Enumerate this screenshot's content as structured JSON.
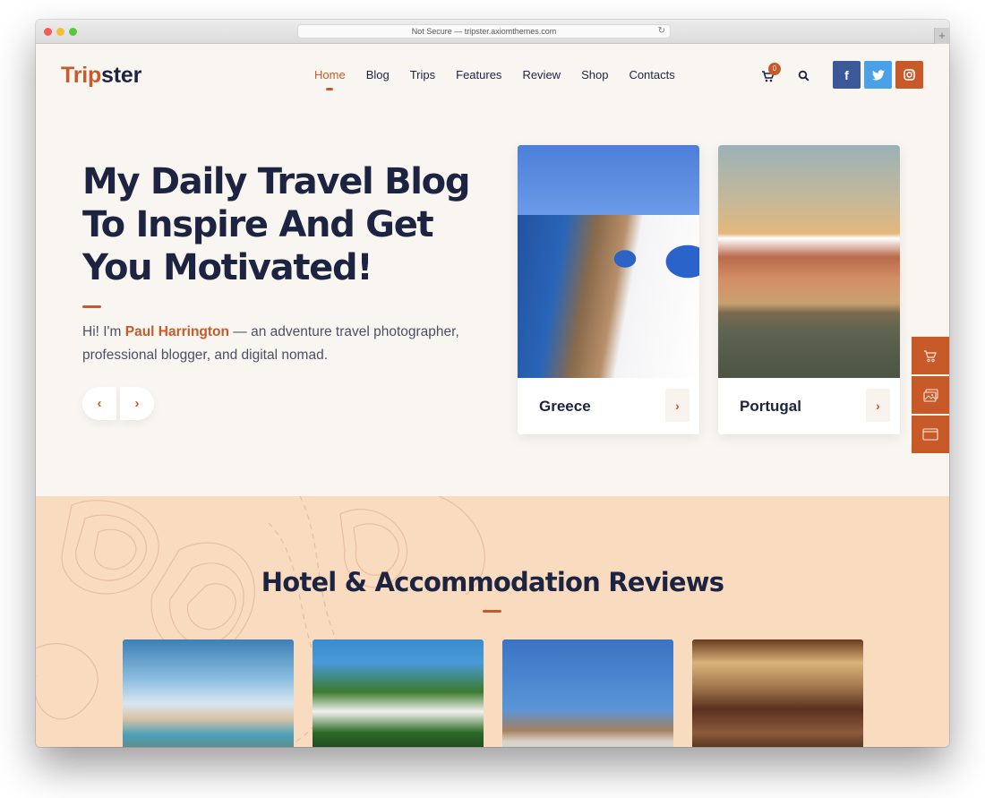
{
  "browser": {
    "url_text": "Not Secure — tripster.axiomthemes.com",
    "reload_icon": "reload-icon",
    "new_tab_label": "+"
  },
  "header": {
    "logo_part1": "Trip",
    "logo_part2": "ster",
    "nav": [
      {
        "label": "Home",
        "active": true
      },
      {
        "label": "Blog"
      },
      {
        "label": "Trips"
      },
      {
        "label": "Features"
      },
      {
        "label": "Review"
      },
      {
        "label": "Shop"
      },
      {
        "label": "Contacts"
      }
    ],
    "cart_count": "0",
    "social": {
      "facebook": "f",
      "twitter": "twitter-bird",
      "instagram": "instagram"
    }
  },
  "hero": {
    "headline": "My Daily Travel Blog To Inspire And Get You Motivated!",
    "intro_prefix": "Hi! I'm ",
    "intro_name": "Paul Harrington",
    "intro_suffix": " — an adventure travel photographer, professional blogger, and digital nomad.",
    "prev_label": "‹",
    "next_label": "›",
    "destinations": [
      {
        "name": "Greece",
        "arrow": "›"
      },
      {
        "name": "Portugal",
        "arrow": "›"
      }
    ]
  },
  "float_panel": {
    "items": [
      "cart-icon",
      "gallery-icon",
      "window-icon"
    ]
  },
  "reviews": {
    "title": "Hotel & Accommodation Reviews",
    "hotels": [
      "Coastal town",
      "Palm resort",
      "Beach cabanas",
      "Hotel lobby"
    ]
  },
  "colors": {
    "accent": "#c85a2a",
    "navy": "#1c2442",
    "hero_bg": "#f9f6f2",
    "reviews_bg": "#f9dbc0",
    "facebook": "#3b5998",
    "twitter": "#4aa1e8"
  }
}
